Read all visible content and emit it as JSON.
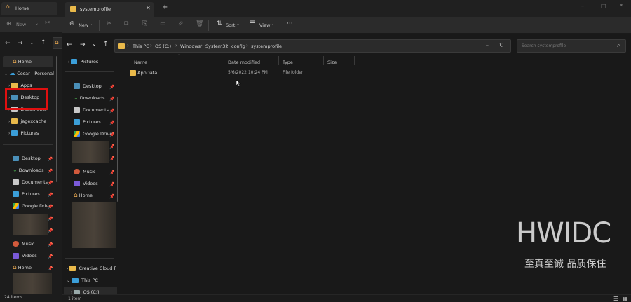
{
  "back_window": {
    "tab_title": "Home",
    "new_label": "New",
    "sidebar": {
      "home": "Home",
      "onedrive": "Cesar - Personal",
      "apps": "Apps",
      "desktop": "Desktop",
      "documents": "Documents",
      "jagexcache": "jagexcache",
      "pictures": "Pictures",
      "quick": [
        "Desktop",
        "Downloads",
        "Documents",
        "Pictures",
        "Google Drive"
      ],
      "music": "Music",
      "videos": "Videos",
      "home2": "Home"
    },
    "status": "24 items"
  },
  "window": {
    "tab_title": "systemprofile",
    "toolbar": {
      "new": "New",
      "sort": "Sort",
      "view": "View",
      "more": "···"
    },
    "breadcrumb": [
      "This PC",
      "OS (C:)",
      "Windows",
      "System32",
      "config",
      "systemprofile"
    ],
    "search_placeholder": "Search systemprofile",
    "sidebar": {
      "pictures_top": "Pictures",
      "desktop": "Desktop",
      "downloads": "Downloads",
      "documents": "Documents",
      "pictures": "Pictures",
      "gdrive": "Google Drive",
      "music": "Music",
      "videos": "Videos",
      "home": "Home",
      "creative": "Creative Cloud F",
      "thispc": "This PC",
      "osc": "OS (C:)"
    },
    "columns": [
      "Name",
      "Date modified",
      "Type",
      "Size"
    ],
    "files": [
      {
        "name": "AppData",
        "date": "5/6/2022 10:24 PM",
        "type": "File folder",
        "size": ""
      }
    ],
    "status": "1 item"
  },
  "watermark": {
    "logo": "HWIDC",
    "tagline": "至真至诚 品质保住"
  },
  "colors": {
    "highlight_box": "#e01010",
    "accent": "#3b9ed8",
    "folder": "#e9b94a"
  }
}
